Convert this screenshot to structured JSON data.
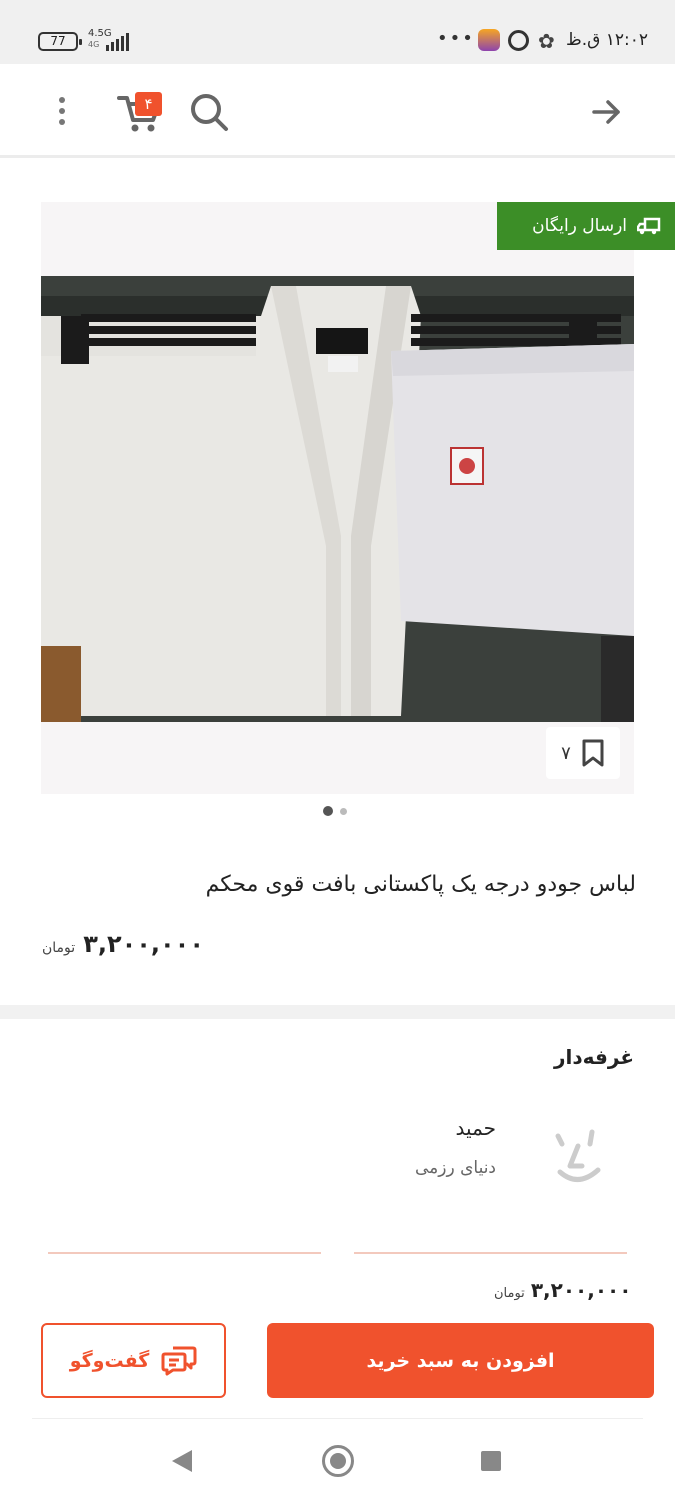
{
  "status_bar": {
    "battery": "77",
    "network": "4.5G",
    "network_sub": "4G",
    "time": "۱۲:۰۲ ق.ظ",
    "overflow": "•••"
  },
  "app_bar": {
    "cart_count": "۴",
    "icons": [
      "more-vert-icon",
      "cart-icon",
      "search-icon",
      "arrow-forward-icon"
    ]
  },
  "gallery": {
    "free_shipping_label": "ارسال رایگان",
    "bookmark_count": "۷",
    "image_count": 2,
    "active_index": 0
  },
  "product": {
    "title": "لباس جودو درجه یک پاکستانی بافت قوی محکم",
    "price": "۳,۲۰۰,۰۰۰",
    "currency": "تومان"
  },
  "seller": {
    "section_title": "غرفه‌دار",
    "name": "حمید",
    "shop": "دنیای رزمی"
  },
  "purchase_bar": {
    "price": "۳,۲۰۰,۰۰۰",
    "currency": "تومان",
    "chat_label": "گفت‌وگو",
    "add_to_cart_label": "افزودن به سبد خرید"
  },
  "colors": {
    "accent": "#f0522d",
    "free_shipping_bg": "#3c8e27"
  }
}
